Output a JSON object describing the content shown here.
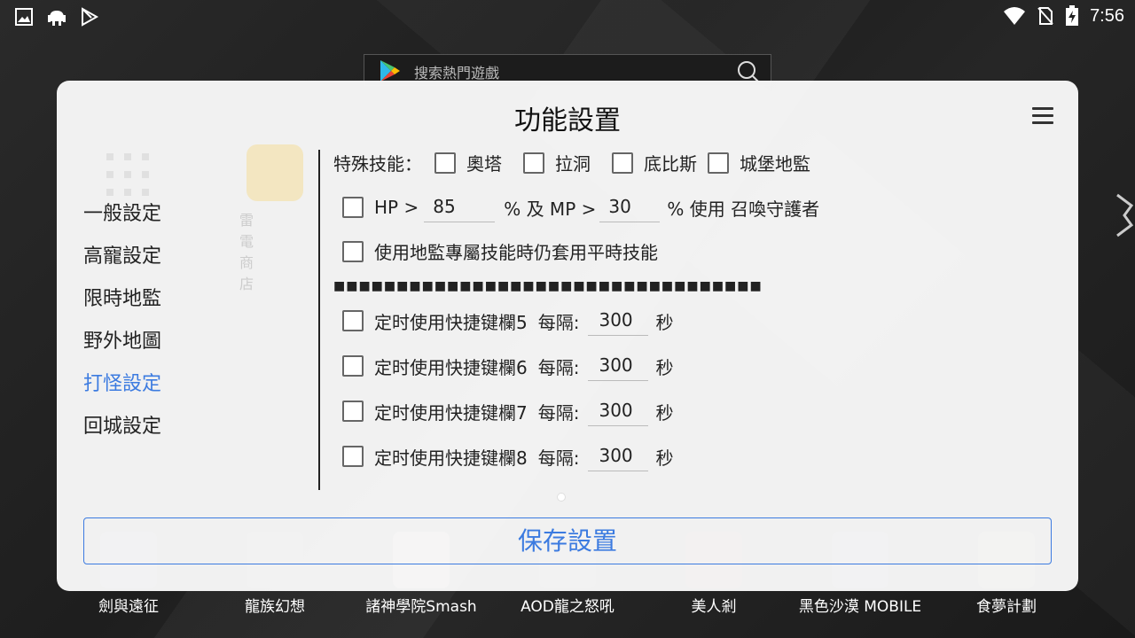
{
  "status_bar": {
    "time": "7:56",
    "left_icons": [
      "image-icon",
      "android-icon",
      "play-store-icon"
    ],
    "right_icons": [
      "wifi-icon",
      "no-sim-icon",
      "battery-charging-icon"
    ]
  },
  "background": {
    "search_placeholder": "搜索熱門遊戲",
    "ghost_app_label": "雷電商店",
    "apps": [
      {
        "name": "劍與遠征"
      },
      {
        "name": "龍族幻想"
      },
      {
        "name": "諸神學院Smash"
      },
      {
        "name": "AOD龍之怒吼"
      },
      {
        "name": "美人剎"
      },
      {
        "name": "黑色沙漠 MOBILE"
      },
      {
        "name": "食夢計劃"
      }
    ]
  },
  "modal": {
    "title": "功能設置",
    "sidebar": [
      {
        "label": "一般設定",
        "active": false
      },
      {
        "label": "高寵設定",
        "active": false
      },
      {
        "label": "限時地監",
        "active": false
      },
      {
        "label": "野外地圖",
        "active": false
      },
      {
        "label": "打怪設定",
        "active": true
      },
      {
        "label": "回城設定",
        "active": false
      }
    ],
    "special_skills": {
      "label": "特殊技能：",
      "options": [
        {
          "label": "奧塔",
          "checked": false
        },
        {
          "label": "拉洞",
          "checked": false
        },
        {
          "label": "底比斯",
          "checked": false
        },
        {
          "label": "城堡地監",
          "checked": false
        }
      ]
    },
    "hp_mp_row": {
      "checked": false,
      "hp_prefix": "HP >",
      "hp_value": "85",
      "mid_text": "% 及 MP >",
      "mp_value": "30",
      "suffix": "% 使用 召喚守護者"
    },
    "dungeon_row": {
      "checked": false,
      "label": "使用地監專屬技能時仍套用平時技能"
    },
    "separator": "■■■■■■■■■■■■■■■■■■■■■■■■■■■■■■■■■■",
    "timed_rows": [
      {
        "label": "定时使用快捷键欄5",
        "interval_label": "每隔:",
        "value": "300",
        "unit": "秒",
        "checked": false
      },
      {
        "label": "定时使用快捷键欄6",
        "interval_label": "每隔:",
        "value": "300",
        "unit": "秒",
        "checked": false
      },
      {
        "label": "定时使用快捷键欄7",
        "interval_label": "每隔:",
        "value": "300",
        "unit": "秒",
        "checked": false
      },
      {
        "label": "定时使用快捷键欄8",
        "interval_label": "每隔:",
        "value": "300",
        "unit": "秒",
        "checked": false
      }
    ],
    "save_label": "保存設置"
  }
}
